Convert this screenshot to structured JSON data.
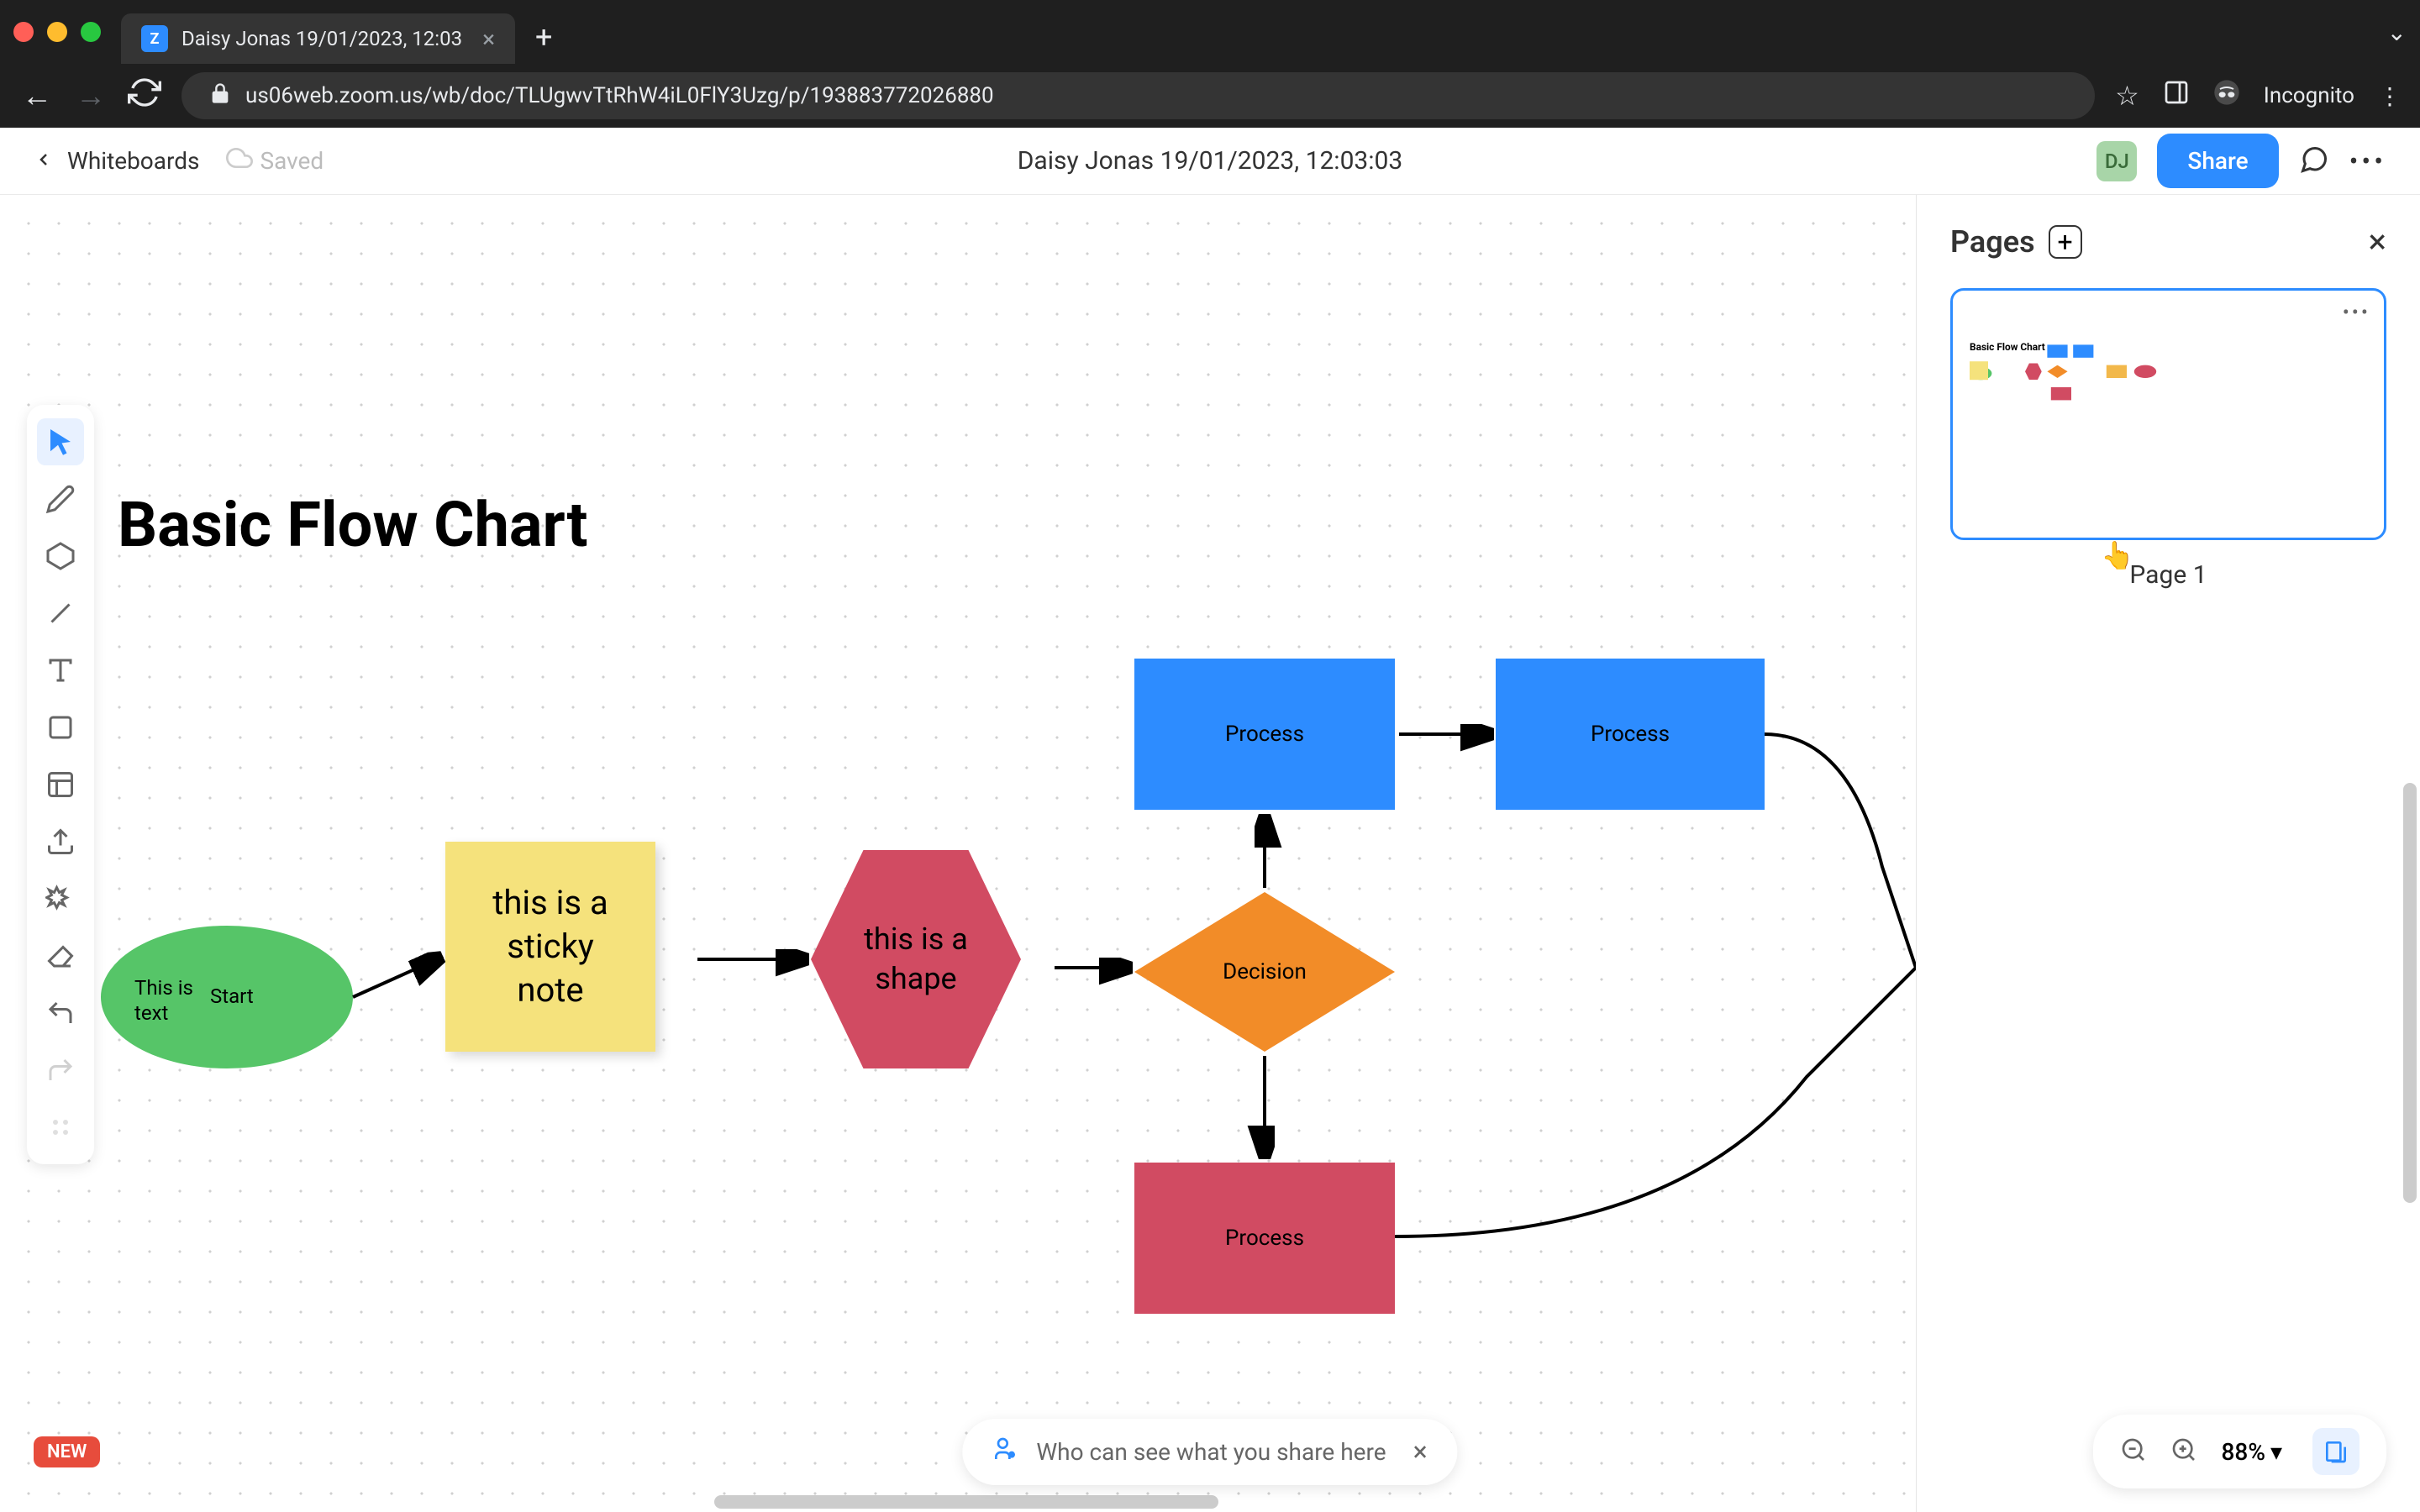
{
  "browser": {
    "tab_title": "Daisy Jonas 19/01/2023, 12:03",
    "url": "us06web.zoom.us/wb/doc/TLUgwvTtRhW4iL0FlY3Uzg/p/193883772026880",
    "incognito_label": "Incognito"
  },
  "header": {
    "whiteboards": "Whiteboards",
    "saved": "Saved",
    "doc_title": "Daisy Jonas 19/01/2023, 12:03:03",
    "avatar_initials": "DJ",
    "share": "Share"
  },
  "canvas": {
    "title": "Basic Flow Chart",
    "start_text1": "This is",
    "start_text2": "text",
    "start_label": "Start",
    "sticky_line1": "this is a",
    "sticky_line2": "sticky",
    "sticky_line3": "note",
    "hex_line1": "this is a",
    "hex_line2": "shape",
    "decision": "Decision",
    "process1": "Process",
    "process2": "Process",
    "process3": "Process"
  },
  "pages": {
    "title": "Pages",
    "page1_label": "Page 1",
    "thumb_title": "Basic Flow Chart"
  },
  "bottom": {
    "new_badge": "NEW",
    "share_hint": "Who can see what you share here",
    "zoom": "88%"
  }
}
